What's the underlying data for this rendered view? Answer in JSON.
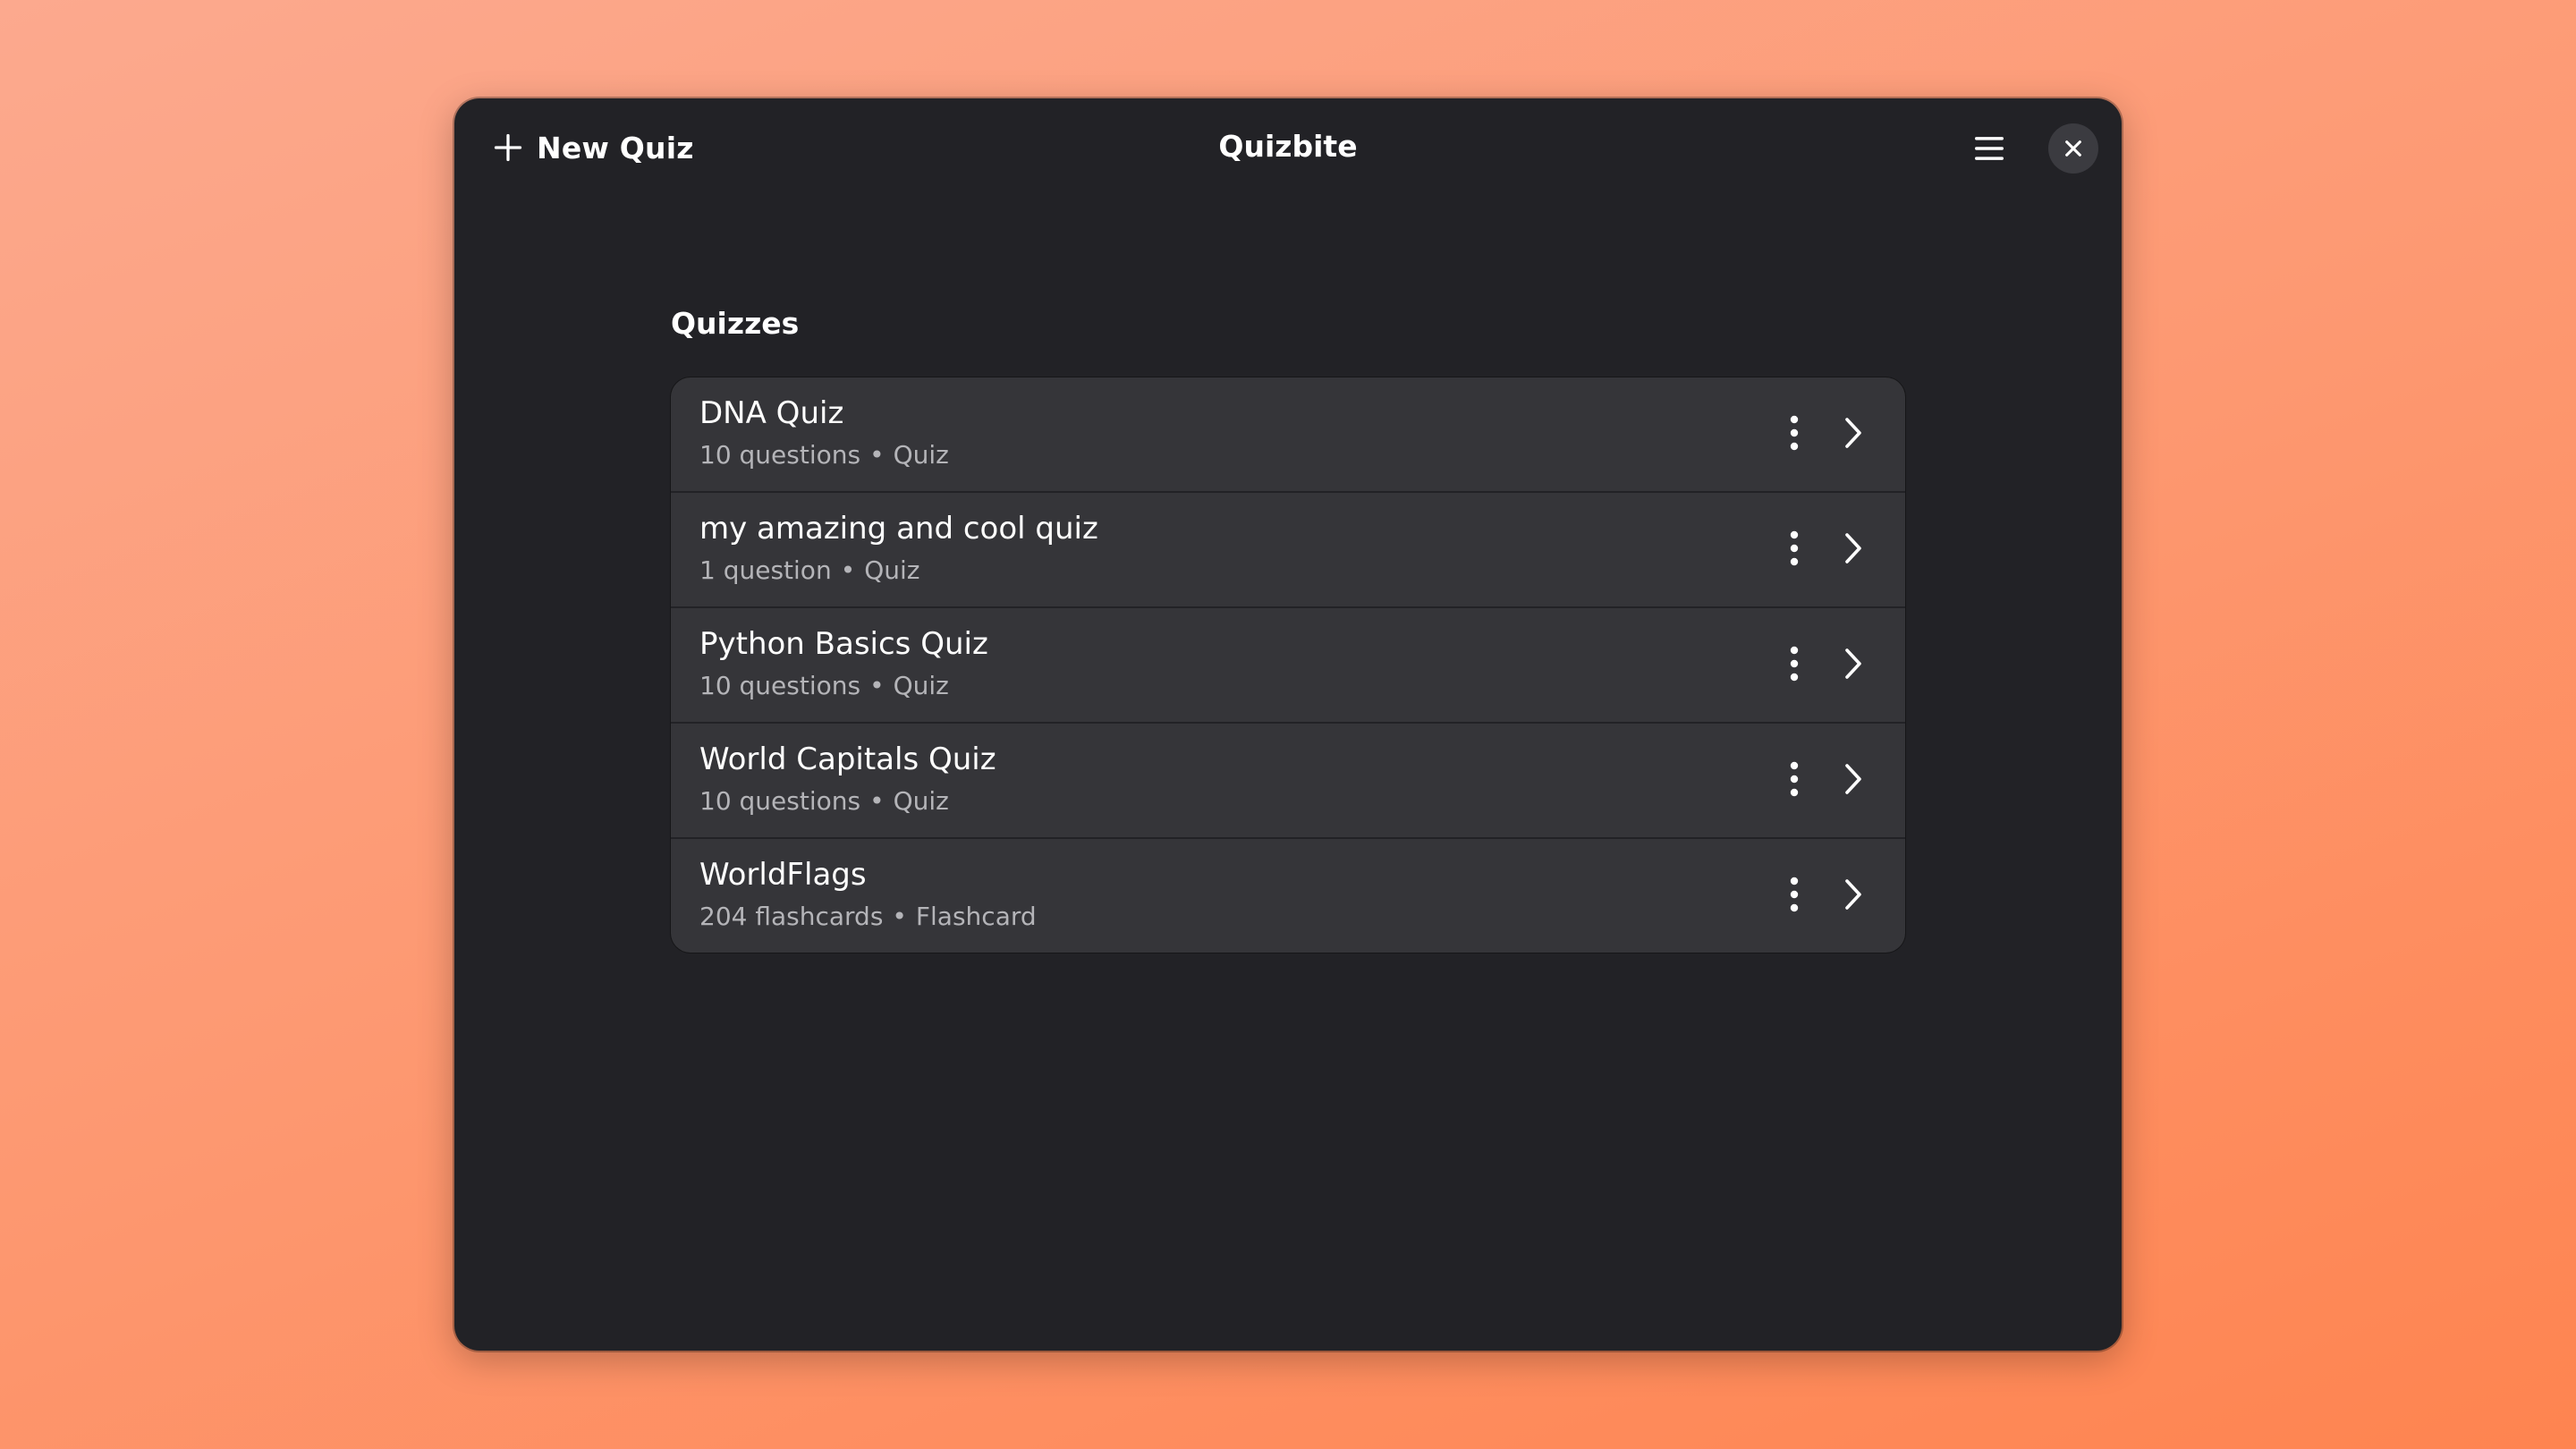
{
  "header": {
    "new_quiz_label": "New Quiz",
    "title": "Quizbite",
    "icons": {
      "new": "plus-icon",
      "menu": "hamburger-menu-icon",
      "close": "close-icon"
    }
  },
  "main": {
    "section_title": "Quizzes",
    "items": [
      {
        "title": "DNA Quiz",
        "count": "10 questions",
        "separator": "•",
        "kind": "Quiz"
      },
      {
        "title": "my amazing and cool quiz",
        "count": "1 question",
        "separator": "•",
        "kind": "Quiz"
      },
      {
        "title": "Python Basics Quiz",
        "count": "10 questions",
        "separator": "•",
        "kind": "Quiz"
      },
      {
        "title": "World Capitals Quiz",
        "count": "10 questions",
        "separator": "•",
        "kind": "Quiz"
      },
      {
        "title": "WorldFlags",
        "count": "204 flashcards",
        "separator": "•",
        "kind": "Flashcard"
      }
    ]
  },
  "colors": {
    "window_bg": "#222226",
    "row_bg": "#353539",
    "subtitle_text": "#b4b4b8",
    "close_button_bg": "#3b3b40",
    "background_gradient_start": "#fca98e",
    "background_gradient_end": "#fe8450"
  }
}
